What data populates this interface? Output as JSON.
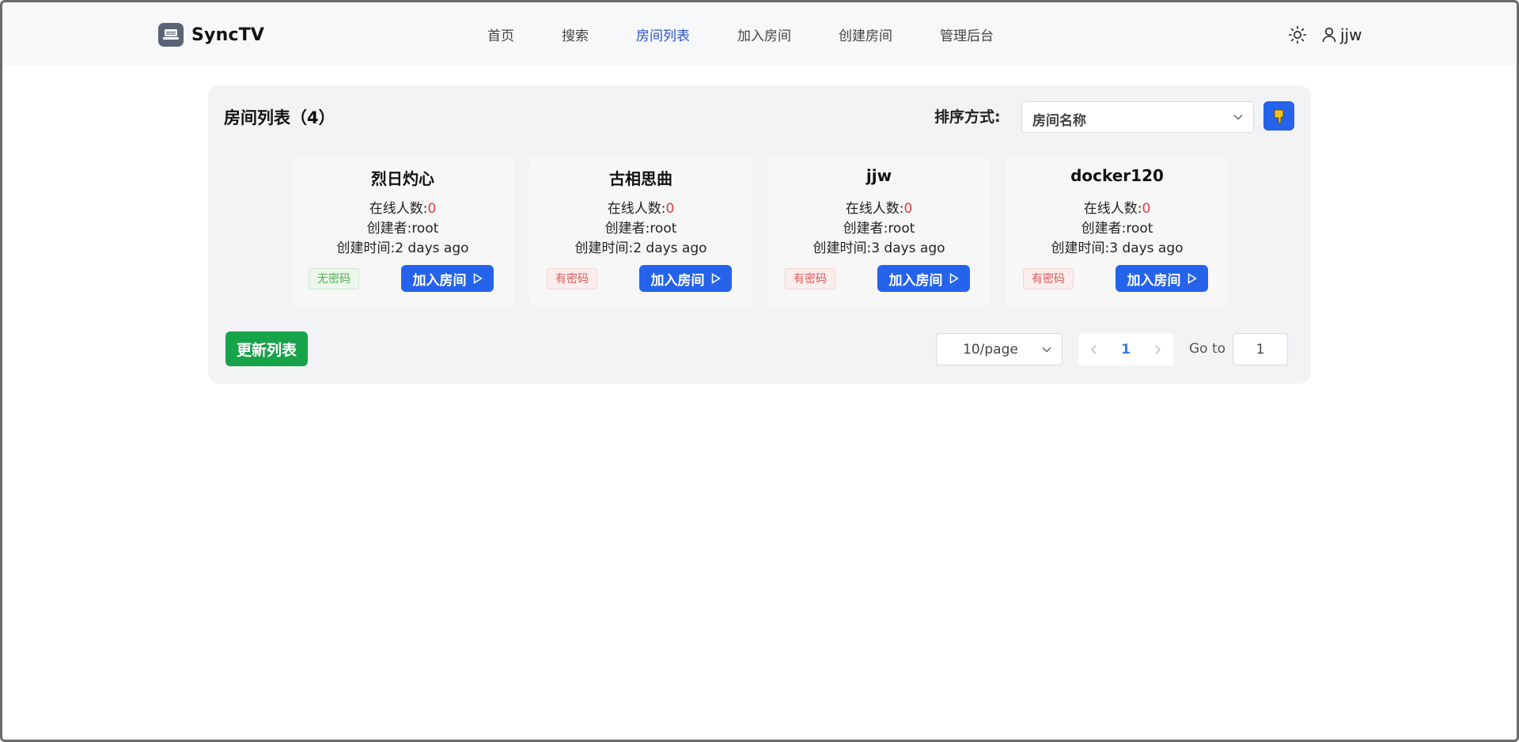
{
  "header": {
    "brand": "SyncTV",
    "nav": [
      {
        "label": "首页"
      },
      {
        "label": "搜索"
      },
      {
        "label": "房间列表",
        "active": true
      },
      {
        "label": "加入房间"
      },
      {
        "label": "创建房间"
      },
      {
        "label": "管理后台"
      }
    ],
    "user": "jjw"
  },
  "panel": {
    "title": "房间列表（4）",
    "sort_label": "排序方式:",
    "sort_value": "房间名称",
    "rooms": [
      {
        "name": "烈日灼心",
        "online_label": "在线人数:",
        "online": "0",
        "creator_label": "创建者:",
        "creator": "root",
        "created_label": "创建时间:",
        "created": "2 days ago",
        "password": "无密码",
        "has_password": false,
        "join": "加入房间"
      },
      {
        "name": "古相思曲",
        "online_label": "在线人数:",
        "online": "0",
        "creator_label": "创建者:",
        "creator": "root",
        "created_label": "创建时间:",
        "created": "2 days ago",
        "password": "有密码",
        "has_password": true,
        "join": "加入房间"
      },
      {
        "name": "jjw",
        "online_label": "在线人数:",
        "online": "0",
        "creator_label": "创建者:",
        "creator": "root",
        "created_label": "创建时间:",
        "created": "3 days ago",
        "password": "有密码",
        "has_password": true,
        "join": "加入房间"
      },
      {
        "name": "docker120",
        "online_label": "在线人数:",
        "online": "0",
        "creator_label": "创建者:",
        "creator": "root",
        "created_label": "创建时间:",
        "created": "3 days ago",
        "password": "有密码",
        "has_password": true,
        "join": "加入房间"
      }
    ],
    "refresh": "更新列表",
    "page_size": "10/page",
    "current_page": "1",
    "goto_label": "Go to",
    "goto_value": "1"
  },
  "colors": {
    "accent": "#2563eb",
    "nav_active": "#2952cc",
    "refresh": "#17a34a",
    "online_count": "#e23b3b"
  },
  "icons": {
    "brand": "tv-icon",
    "theme": "sun-icon",
    "user": "user-icon",
    "sort_order": "hand-pointing-down-icon",
    "join": "play-icon"
  }
}
